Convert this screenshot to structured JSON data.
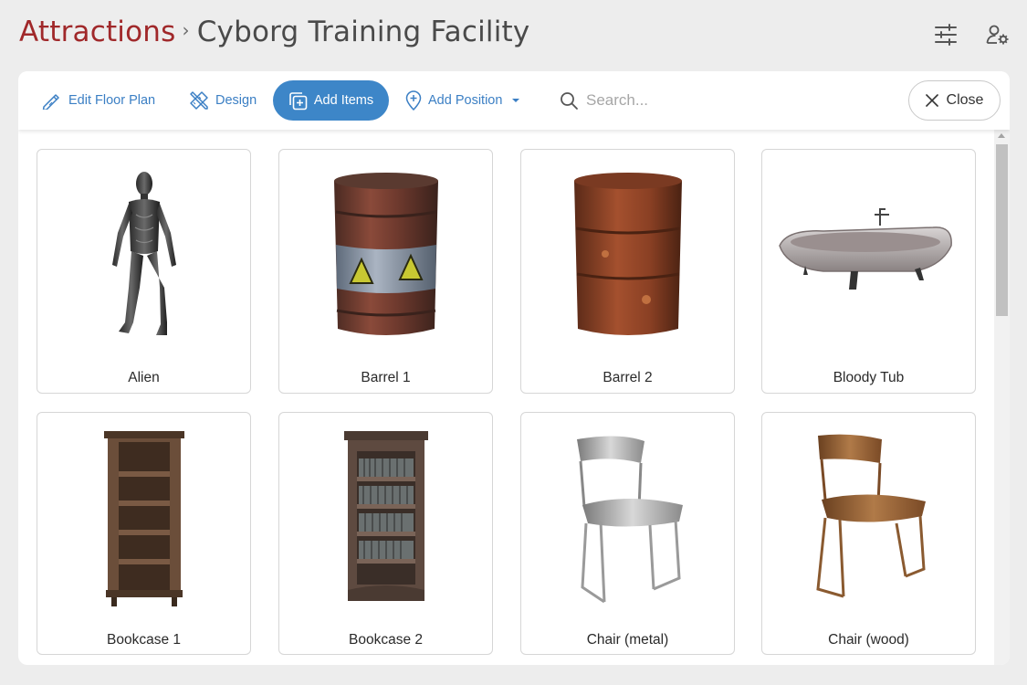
{
  "breadcrumb": {
    "root": "Attractions",
    "separator": "›",
    "current": "Cyborg Training Facility"
  },
  "header_icons": [
    "sliders-icon",
    "user-settings-icon"
  ],
  "toolbar": {
    "edit_floor_plan": "Edit Floor Plan",
    "design": "Design",
    "add_items": "Add Items",
    "add_position": "Add Position",
    "search_placeholder": "Search...",
    "close": "Close"
  },
  "colors": {
    "brand_red": "#a0282a",
    "accent_blue": "#3d86c8",
    "link_blue": "#3b7fc4"
  },
  "items": [
    {
      "name": "Alien",
      "icon": "alien-model"
    },
    {
      "name": "Barrel 1",
      "icon": "barrel-hazard-model"
    },
    {
      "name": "Barrel 2",
      "icon": "barrel-rusty-model"
    },
    {
      "name": "Bloody Tub",
      "icon": "bathtub-model"
    },
    {
      "name": "Bookcase 1",
      "icon": "bookcase-empty-model"
    },
    {
      "name": "Bookcase 2",
      "icon": "bookcase-books-model"
    },
    {
      "name": "Chair (metal)",
      "icon": "chair-metal-model"
    },
    {
      "name": "Chair (wood)",
      "icon": "chair-wood-model"
    }
  ]
}
